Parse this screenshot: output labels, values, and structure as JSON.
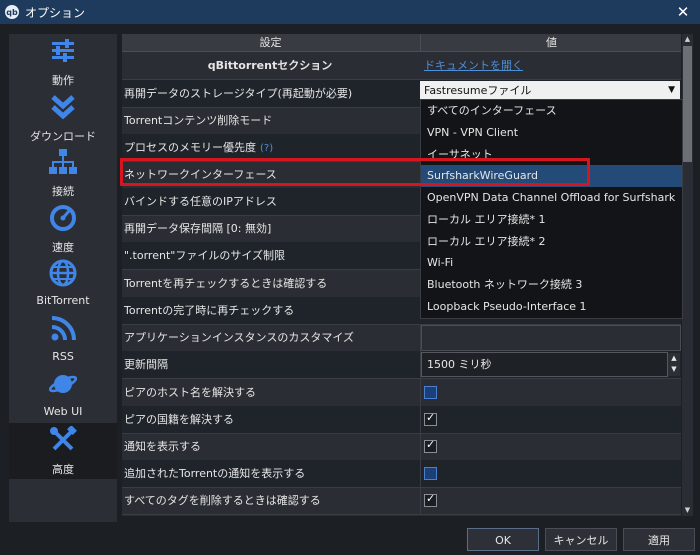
{
  "window": {
    "title": "オプション",
    "app_icon_text": "qb",
    "close_glyph": "✕"
  },
  "sidebar": {
    "items": [
      {
        "label": "動作",
        "icon": "sliders-icon"
      },
      {
        "label": "ダウンロード",
        "icon": "download-chevrons-icon"
      },
      {
        "label": "接続",
        "icon": "network-icon"
      },
      {
        "label": "速度",
        "icon": "speedometer-icon"
      },
      {
        "label": "BitTorrent",
        "icon": "globe-icon"
      },
      {
        "label": "RSS",
        "icon": "rss-icon"
      },
      {
        "label": "Web UI",
        "icon": "planet-icon"
      },
      {
        "label": "高度",
        "icon": "tools-icon",
        "active": true
      }
    ]
  },
  "table": {
    "headers": {
      "setting": "設定",
      "value": "値"
    },
    "rows": [
      {
        "name": "qBittorrentセクション",
        "value": "ドキュメントを開く"
      },
      {
        "name": "再開データのストレージタイプ(再起動が必要)",
        "value": "Fastresumeファイル"
      },
      {
        "name": "Torrentコンテンツ削除モード"
      },
      {
        "name": "プロセスのメモリー優先度",
        "help": "(?)"
      },
      {
        "name": "ネットワークインターフェース"
      },
      {
        "name": "バインドする任意のIPアドレス"
      },
      {
        "name": "再開データ保存間隔 [0: 無効]"
      },
      {
        "name": "\".torrent\"ファイルのサイズ制限"
      },
      {
        "name": "Torrentを再チェックするときは確認する"
      },
      {
        "name": "Torrentの完了時に再チェックする"
      },
      {
        "name": "アプリケーションインスタンスのカスタマイズ"
      },
      {
        "name": "更新間隔",
        "value": "1500 ミリ秒"
      },
      {
        "name": "ピアのホスト名を解決する",
        "checked": false
      },
      {
        "name": "ピアの国籍を解決する",
        "checked": true
      },
      {
        "name": "通知を表示する",
        "checked": true
      },
      {
        "name": "追加されたTorrentの通知を表示する",
        "checked": false
      },
      {
        "name": "すべてのタグを削除するときは確認する",
        "checked": true
      }
    ]
  },
  "dropdown": {
    "selected": "SurfsharkWireGuard",
    "options": [
      "すべてのインターフェース",
      "VPN - VPN Client",
      "イーサネット",
      "SurfsharkWireGuard",
      "OpenVPN Data Channel Offload for Surfshark",
      "ローカル エリア接続* 1",
      "ローカル エリア接続* 2",
      "Wi-Fi",
      "Bluetooth ネットワーク接続 3",
      "Loopback Pseudo-Interface 1"
    ]
  },
  "buttons": {
    "ok": "OK",
    "cancel": "キャンセル",
    "apply": "適用"
  },
  "colors": {
    "titlebar": "#1e3a5c",
    "highlight": "#d6151e",
    "selected": "#244a78",
    "icon": "#3f86e8"
  }
}
